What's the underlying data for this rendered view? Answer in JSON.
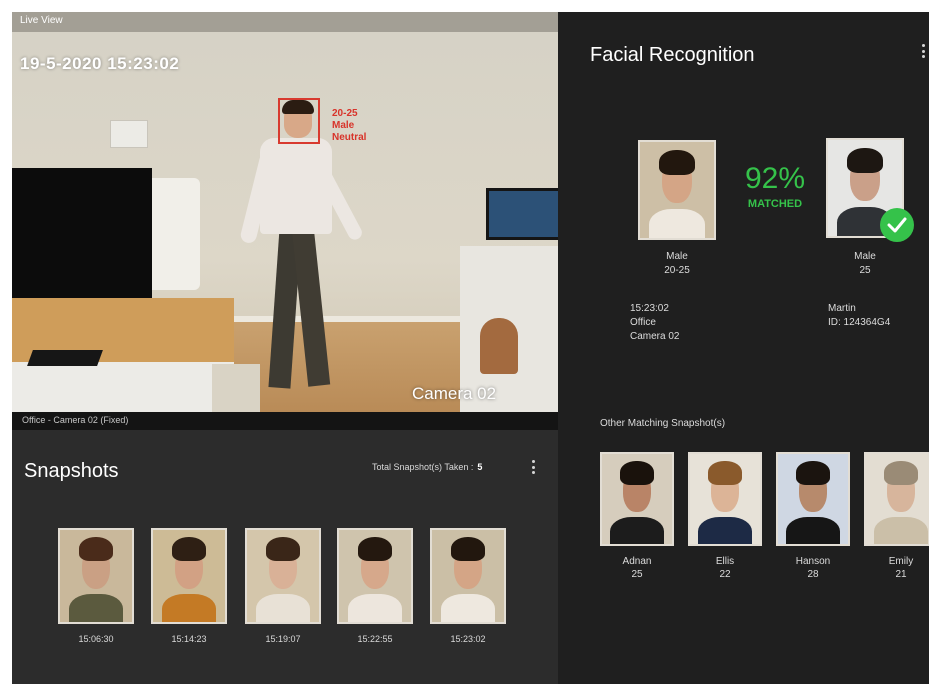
{
  "live_view": {
    "header": "Live View",
    "timestamp": "19-5-2020  15:23:02",
    "camera_label": "Camera  02",
    "caption": "Office - Camera 02 (Fixed)",
    "detection": {
      "age": "20-25",
      "gender": "Male",
      "emotion": "Neutral"
    }
  },
  "snapshots": {
    "title": "Snapshots",
    "total_label": "Total Snapshot(s) Taken :",
    "total_value": "5",
    "items": [
      {
        "time": "15:06:30"
      },
      {
        "time": "15:14:23"
      },
      {
        "time": "15:19:07"
      },
      {
        "time": "15:22:55"
      },
      {
        "time": "15:23:02"
      }
    ]
  },
  "facial_recognition": {
    "title": "Facial Recognition",
    "match_percent": "92%",
    "match_label": "MATCHED",
    "left": {
      "gender": "Male",
      "age": "20-25",
      "time": "15:23:02",
      "location": "Office",
      "camera": "Camera 02"
    },
    "right": {
      "gender": "Male",
      "age": "25",
      "name": "Martin",
      "id": "ID: 124364G4"
    },
    "other_title": "Other Matching Snapshot(s)",
    "others": [
      {
        "name": "Adnan",
        "age": "25"
      },
      {
        "name": "Ellis",
        "age": "22"
      },
      {
        "name": "Hanson",
        "age": "28"
      },
      {
        "name": "Emily",
        "age": "21"
      }
    ]
  },
  "colors": {
    "accent_green": "#35c24a",
    "detection_red": "#d83a2f",
    "panel_dark": "#1f1f1f",
    "panel_mid": "#2c2c2c"
  },
  "icons": [
    "kebab-menu-icon",
    "check-circle-icon"
  ]
}
